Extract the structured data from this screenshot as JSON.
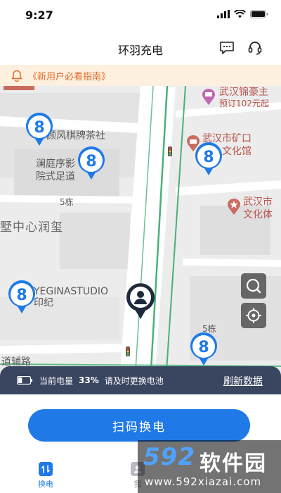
{
  "status_bar": {
    "time": "9:27"
  },
  "header": {
    "title": "环羽充电"
  },
  "notice": {
    "text": "《新用户必看指南》"
  },
  "map": {
    "labels": [
      "顾风棋牌茶社",
      "澜庭序影",
      "院式足道",
      "5栋",
      "墅中心润玺",
      "YEGINASTUDIO",
      "印纪",
      "道辅路",
      "5栋",
      "武汉锦豪主",
      "预订102元起",
      "武汉市矿口",
      "文化馆",
      "武汉市",
      "文化体"
    ],
    "station_glyph": "8"
  },
  "battery": {
    "label": "当前电量",
    "percent": "33%",
    "level": 0.33,
    "hint": "请及时更换电池",
    "refresh": "刷新数据"
  },
  "action": {
    "scan_label": "扫码换电"
  },
  "tabs": [
    {
      "label": "换电",
      "active": true
    },
    {
      "label": "我"
    }
  ],
  "watermark": {
    "logo": "592",
    "brand": "软件园",
    "url": "www.592xiazai.com"
  },
  "colors": {
    "accent": "#1f7ae8",
    "notice_bg": "#fdf0df",
    "notice_text": "#e26a2c",
    "battery_bar": "#3a4660",
    "road_green": "#4bb07a"
  }
}
